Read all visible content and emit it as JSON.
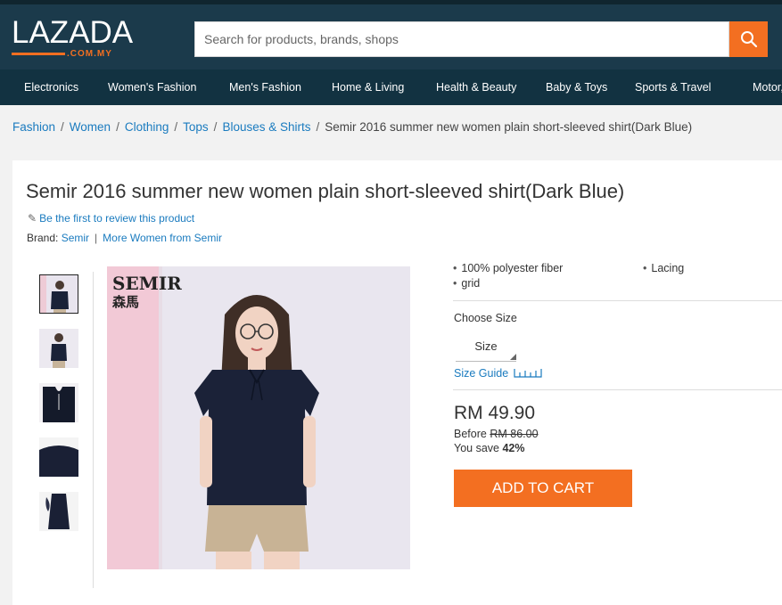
{
  "header": {
    "logo_text": "LAZADA",
    "logo_domain": ".COM.MY",
    "search_placeholder": "Search for products, brands, shops",
    "search_icon": "search-icon",
    "brand_color": "#f36f21",
    "header_color": "#1b3a4b"
  },
  "nav": {
    "items": [
      "Electronics",
      "Women's Fashion",
      "Men's Fashion",
      "Home & Living",
      "Health & Beauty",
      "Baby & Toys",
      "Sports & Travel",
      "Motor,"
    ]
  },
  "breadcrumb": {
    "links": [
      "Fashion",
      "Women",
      "Clothing",
      "Tops",
      "Blouses & Shirts"
    ],
    "separator": "/",
    "current": "Semir 2016 summer new women plain short-sleeved shirt(Dark Blue)"
  },
  "product": {
    "title": "Semir 2016 summer new women plain short-sleeved shirt(Dark Blue)",
    "review_link": "Be the first to review this product",
    "brand_label": "Brand:",
    "brand_name": "Semir",
    "brand_separator": "|",
    "more_from": "More Women from Semir",
    "image_brand_logo": "SEMIR",
    "image_brand_chinese": "森馬",
    "features": [
      "100% polyester fiber",
      "Lacing",
      "grid"
    ],
    "choose_size_label": "Choose Size",
    "size_select_value": "Size",
    "size_guide_label": "Size Guide",
    "price": "RM 49.90",
    "before_label": "Before",
    "before_price": "RM 86.00",
    "save_label": "You save",
    "save_percent": "42%",
    "add_to_cart": "ADD TO CART"
  }
}
